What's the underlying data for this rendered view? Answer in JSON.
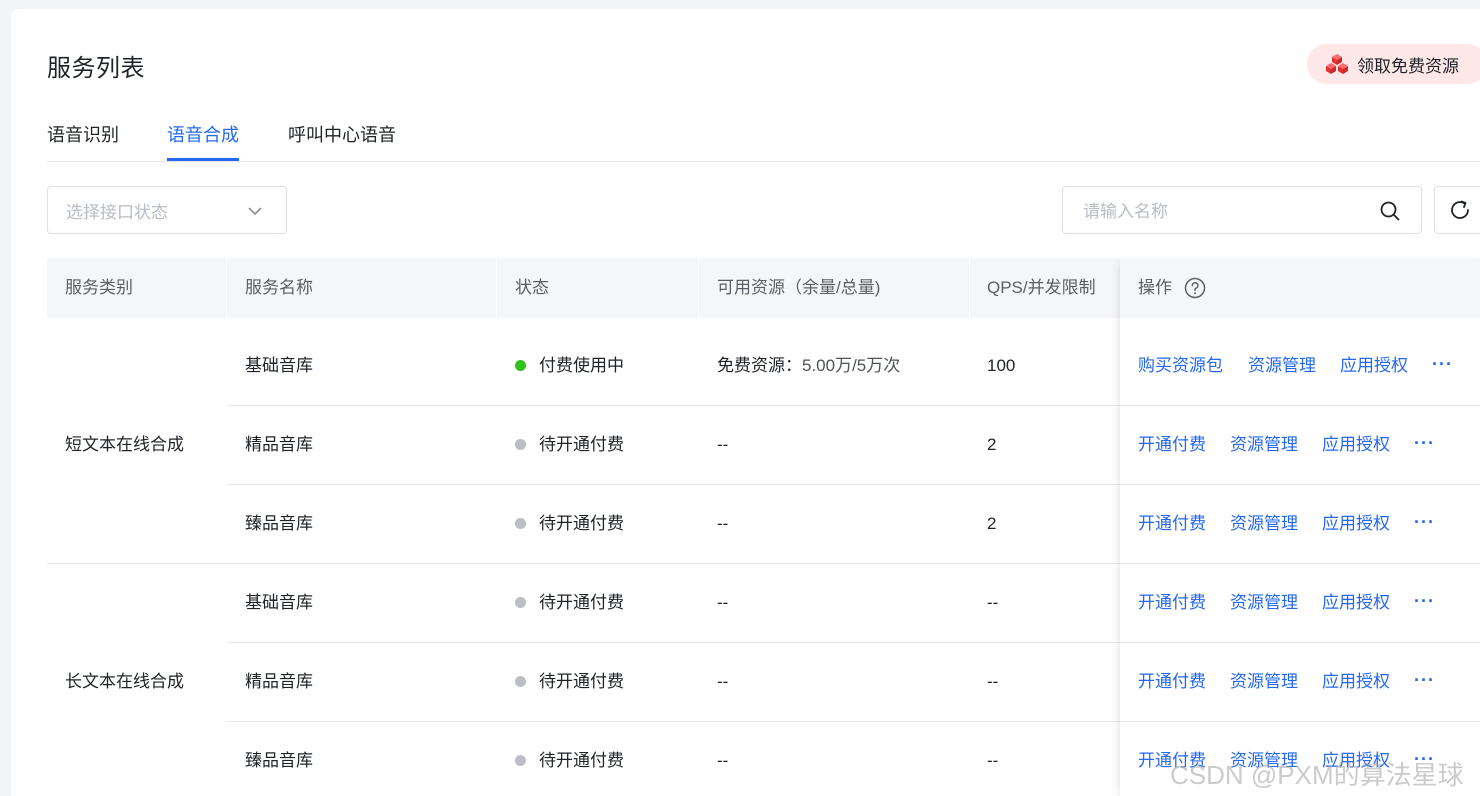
{
  "page_title": "服务列表",
  "promo_button": "领取免费资源",
  "tabs": [
    {
      "label": "语音识别",
      "active": false
    },
    {
      "label": "语音合成",
      "active": true
    },
    {
      "label": "呼叫中心语音",
      "active": false
    }
  ],
  "filter": {
    "status_placeholder": "选择接口状态"
  },
  "search": {
    "placeholder": "请输入名称"
  },
  "table": {
    "headers": [
      "服务类别",
      "服务名称",
      "状态",
      "可用资源（余量/总量)",
      "QPS/并发限制",
      "操作"
    ],
    "groups": [
      {
        "category": "短文本在线合成",
        "rows": [
          {
            "name": "基础音库",
            "status": "付费使用中",
            "status_color": "#2fc21b",
            "resource_label": "免费资源：",
            "resource_value": "5.00万/5万次",
            "qps": "100",
            "actions": [
              "购买资源包",
              "资源管理",
              "应用授权"
            ]
          },
          {
            "name": "精品音库",
            "status": "待开通付费",
            "status_color": "#bcbec3",
            "resource_label": "",
            "resource_value": "--",
            "qps": "2",
            "actions": [
              "开通付费",
              "资源管理",
              "应用授权"
            ]
          },
          {
            "name": "臻品音库",
            "status": "待开通付费",
            "status_color": "#bcbec3",
            "resource_label": "",
            "resource_value": "--",
            "qps": "2",
            "actions": [
              "开通付费",
              "资源管理",
              "应用授权"
            ]
          }
        ]
      },
      {
        "category": "长文本在线合成",
        "rows": [
          {
            "name": "基础音库",
            "status": "待开通付费",
            "status_color": "#bcbec3",
            "resource_label": "",
            "resource_value": "--",
            "qps": "--",
            "actions": [
              "开通付费",
              "资源管理",
              "应用授权"
            ]
          },
          {
            "name": "精品音库",
            "status": "待开通付费",
            "status_color": "#bcbec3",
            "resource_label": "",
            "resource_value": "--",
            "qps": "--",
            "actions": [
              "开通付费",
              "资源管理",
              "应用授权"
            ]
          },
          {
            "name": "臻品音库",
            "status": "待开通付费",
            "status_color": "#bcbec3",
            "resource_label": "",
            "resource_value": "--",
            "qps": "--",
            "actions": [
              "开通付费",
              "资源管理",
              "应用授权"
            ]
          }
        ]
      }
    ],
    "more_label": "···"
  },
  "watermark": "CSDN @PXM的算法星球",
  "colors": {
    "accent": "#2468f2",
    "status_active": "#2fc21b",
    "status_pending": "#bcbec3",
    "promo_bg": "#fde7e7"
  },
  "icons": {
    "promo": "red-cubes-icon",
    "select": "chevron-down-icon",
    "search": "search-icon",
    "refresh": "refresh-icon",
    "help": "question-circle-icon"
  }
}
